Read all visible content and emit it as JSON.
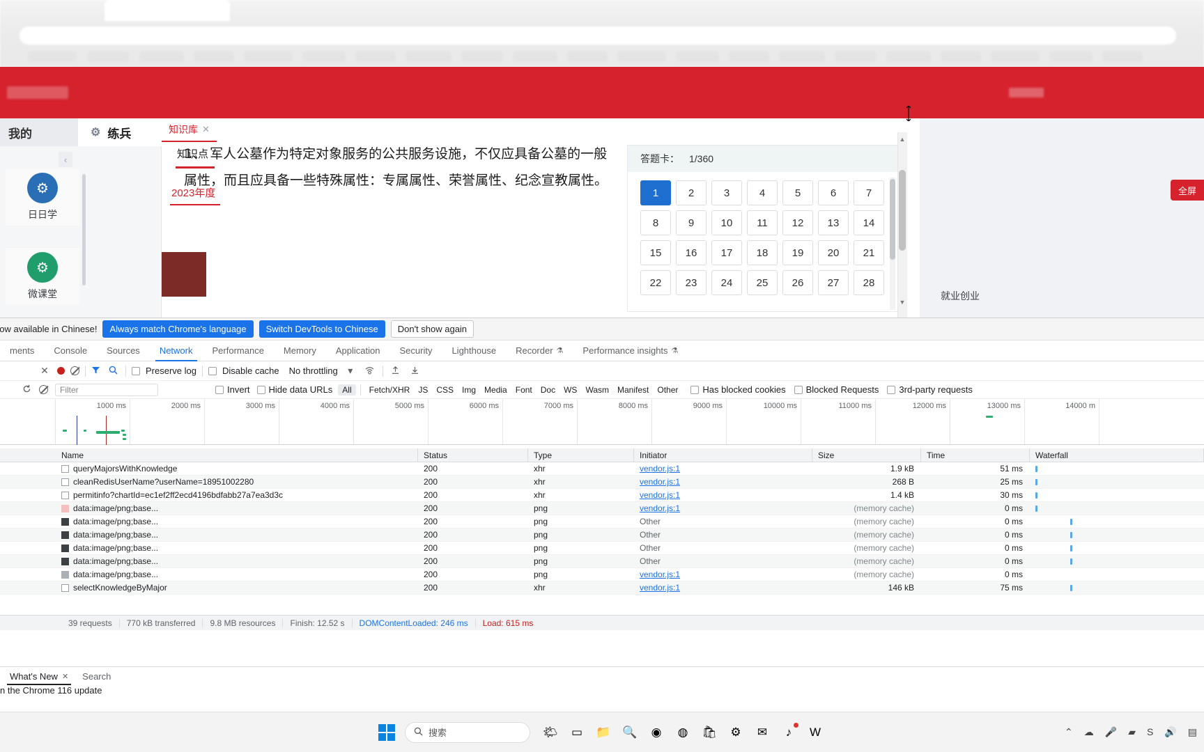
{
  "browser": {
    "omnibox_placeholder": "",
    "blurred": true
  },
  "site": {
    "left_tabs": [
      {
        "label": "我的"
      },
      {
        "label": "练兵",
        "icon": "gear-icon"
      }
    ],
    "collapse_arrow": "‹",
    "side_cards": [
      {
        "label": "日日学",
        "icon": "gear-icon",
        "color": "#2a6fb5"
      },
      {
        "label": "微课堂",
        "icon": "gear-icon",
        "color": "#1f9d6b"
      }
    ],
    "kb_tab": {
      "label": "知识库",
      "close": "✕"
    },
    "mid": {
      "title": "知识点",
      "year": "2023年度"
    },
    "question": "1、 军人公墓作为特定对象服务的公共服务设施，不仅应具备公墓的一般属性，而且应具备一些特殊属性：专属属性、荣誉属性、纪念宣教属性。",
    "answer_card": {
      "title": "答题卡：",
      "progress": "1/360",
      "cells": [
        "1",
        "2",
        "3",
        "4",
        "5",
        "6",
        "7",
        "8",
        "9",
        "10",
        "11",
        "12",
        "13",
        "14",
        "15",
        "16",
        "17",
        "18",
        "19",
        "20",
        "21",
        "22",
        "23",
        "24",
        "25",
        "26",
        "27",
        "28"
      ],
      "active_index": 0
    },
    "right_strip": {
      "red_button": "全屏",
      "label": "就业创业"
    }
  },
  "devtools": {
    "banner": {
      "message": "now available in Chinese!",
      "buttons": [
        {
          "label": "Always match Chrome's language",
          "style": "blue"
        },
        {
          "label": "Switch DevTools to Chinese",
          "style": "blue"
        },
        {
          "label": "Don't show again",
          "style": "plain"
        }
      ]
    },
    "tabs": [
      {
        "label": "ments"
      },
      {
        "label": "Console"
      },
      {
        "label": "Sources"
      },
      {
        "label": "Network",
        "active": true
      },
      {
        "label": "Performance"
      },
      {
        "label": "Memory"
      },
      {
        "label": "Application"
      },
      {
        "label": "Security"
      },
      {
        "label": "Lighthouse"
      },
      {
        "label": "Recorder",
        "badge": "⚗"
      },
      {
        "label": "Performance insights",
        "badge": "⚗"
      }
    ],
    "toolbar": {
      "close_icon": "✕",
      "record_icon": "record-icon",
      "clear_icon": "clear-icon",
      "filter_icon": "funnel-icon",
      "search_icon": "search-icon",
      "preserve_log": "Preserve log",
      "disable_cache": "Disable cache",
      "throttling": "No throttling",
      "throttling_caret": "▾",
      "wifi_icon": "wifi-settings-icon",
      "import_icon": "import-har-icon",
      "export_icon": "export-har-icon"
    },
    "filterbar": {
      "reload_icon": "reload-icon",
      "clear_icon": "clear-icon",
      "filter_placeholder": "Filter",
      "invert": "Invert",
      "hide_data_urls": "Hide data URLs",
      "types": [
        "All",
        "Fetch/XHR",
        "JS",
        "CSS",
        "Img",
        "Media",
        "Font",
        "Doc",
        "WS",
        "Wasm",
        "Manifest",
        "Other"
      ],
      "selected_type": "All",
      "has_blocked_cookies": "Has blocked cookies",
      "blocked_requests": "Blocked Requests",
      "third_party": "3rd-party requests"
    },
    "overview_ticks": [
      "1000 ms",
      "2000 ms",
      "3000 ms",
      "4000 ms",
      "5000 ms",
      "6000 ms",
      "7000 ms",
      "8000 ms",
      "9000 ms",
      "10000 ms",
      "11000 ms",
      "12000 ms",
      "13000 ms",
      "14000 m"
    ],
    "columns": [
      "Name",
      "Status",
      "Type",
      "Initiator",
      "Size",
      "Time",
      "Waterfall"
    ],
    "rows": [
      {
        "icon": "doc-icon",
        "name": "queryMajorsWithKnowledge",
        "status": "200",
        "type": "xhr",
        "initiator": "vendor.js:1",
        "initiator_link": true,
        "size": "1.9 kB",
        "time": "51 ms"
      },
      {
        "icon": "doc-icon",
        "name": "cleanRedisUserName?userName=18951002280",
        "status": "200",
        "type": "xhr",
        "initiator": "vendor.js:1",
        "initiator_link": true,
        "size": "268 B",
        "time": "25 ms"
      },
      {
        "icon": "doc-icon",
        "name": "permitinfo?chartId=ec1ef2ff2ecd4196bdfabb27a7ea3d3c",
        "status": "200",
        "type": "xhr",
        "initiator": "vendor.js:1",
        "initiator_link": true,
        "size": "1.4 kB",
        "time": "30 ms"
      },
      {
        "icon": "img-pink-icon",
        "name": "data:image/png;base...",
        "status": "200",
        "type": "png",
        "initiator": "vendor.js:1",
        "initiator_link": true,
        "size": "(memory cache)",
        "time": "0 ms"
      },
      {
        "icon": "img-icon",
        "name": "data:image/png;base...",
        "status": "200",
        "type": "png",
        "initiator": "Other",
        "initiator_link": false,
        "size": "(memory cache)",
        "time": "0 ms"
      },
      {
        "icon": "img-icon",
        "name": "data:image/png;base...",
        "status": "200",
        "type": "png",
        "initiator": "Other",
        "initiator_link": false,
        "size": "(memory cache)",
        "time": "0 ms"
      },
      {
        "icon": "img-icon",
        "name": "data:image/png;base...",
        "status": "200",
        "type": "png",
        "initiator": "Other",
        "initiator_link": false,
        "size": "(memory cache)",
        "time": "0 ms"
      },
      {
        "icon": "img-icon",
        "name": "data:image/png;base...",
        "status": "200",
        "type": "png",
        "initiator": "Other",
        "initiator_link": false,
        "size": "(memory cache)",
        "time": "0 ms"
      },
      {
        "icon": "img-light-icon",
        "name": "data:image/png;base...",
        "status": "200",
        "type": "png",
        "initiator": "vendor.js:1",
        "initiator_link": true,
        "size": "(memory cache)",
        "time": "0 ms"
      },
      {
        "icon": "doc-icon",
        "name": "selectKnowledgeByMajor",
        "status": "200",
        "type": "xhr",
        "initiator": "vendor.js:1",
        "initiator_link": true,
        "size": "146 kB",
        "time": "75 ms"
      }
    ],
    "status_bar": {
      "requests": "39 requests",
      "transferred": "770 kB transferred",
      "resources": "9.8 MB resources",
      "finish": "Finish: 12.52 s",
      "domcontentloaded": "DOMContentLoaded: 246 ms",
      "load": "Load: 615 ms"
    },
    "drawer": {
      "tabs": [
        {
          "label": "What's New",
          "active": true,
          "close": "✕"
        },
        {
          "label": "Search",
          "active": false
        }
      ],
      "body": "n the Chrome 116 update"
    }
  },
  "taskbar": {
    "start_icon": "windows-icon",
    "search_placeholder": "搜索",
    "search_icon": "search-icon",
    "apps": [
      {
        "name": "widgets-icon",
        "glyph": "🌤"
      },
      {
        "name": "task-view-icon",
        "glyph": "▭"
      },
      {
        "name": "file-explorer-icon",
        "glyph": "📁"
      },
      {
        "name": "search-app-icon",
        "glyph": "🔍"
      },
      {
        "name": "edge-icon",
        "glyph": "◉"
      },
      {
        "name": "chrome-icon",
        "glyph": "◍"
      },
      {
        "name": "store-icon",
        "glyph": "🛍"
      },
      {
        "name": "settings-app-icon",
        "glyph": "⚙"
      },
      {
        "name": "mail-icon",
        "glyph": "✉"
      },
      {
        "name": "music-icon",
        "glyph": "♪"
      },
      {
        "name": "wps-icon",
        "glyph": "W"
      }
    ],
    "tray": [
      {
        "name": "chevron-up-icon",
        "glyph": "⌃"
      },
      {
        "name": "cloud-icon",
        "glyph": "☁"
      },
      {
        "name": "mic-icon",
        "glyph": "🎤"
      },
      {
        "name": "network-icon",
        "glyph": "▰"
      },
      {
        "name": "sogou-icon",
        "glyph": "S"
      },
      {
        "name": "volume-icon",
        "glyph": "🔊"
      },
      {
        "name": "notification-icon",
        "glyph": "▤"
      }
    ]
  },
  "colors": {
    "brand_red": "#d5222d",
    "accent_blue": "#1a73e8",
    "active_cell": "#1f6fd0",
    "status_red": "#c5221f"
  }
}
